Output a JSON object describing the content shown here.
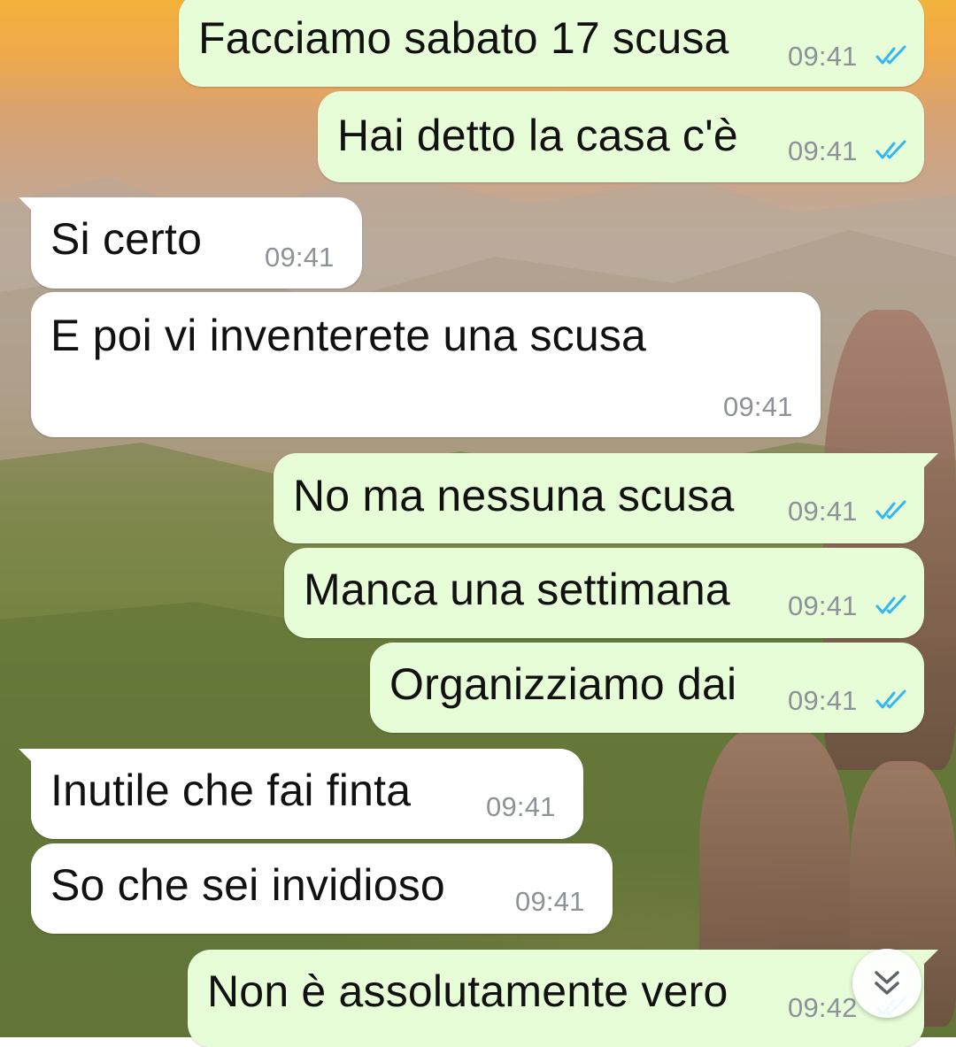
{
  "messages": [
    {
      "text": "Facciamo sabato 17 scusa",
      "time": "09:41",
      "direction": "out",
      "status": "read"
    },
    {
      "text": "Hai detto la casa c'è",
      "time": "09:41",
      "direction": "out",
      "status": "read"
    },
    {
      "text": "Si certo",
      "time": "09:41",
      "direction": "in"
    },
    {
      "text": "E poi vi inventerete una scusa",
      "time": "09:41",
      "direction": "in"
    },
    {
      "text": "No ma nessuna scusa",
      "time": "09:41",
      "direction": "out",
      "status": "read"
    },
    {
      "text": "Manca una settimana",
      "time": "09:41",
      "direction": "out",
      "status": "read"
    },
    {
      "text": "Organizziamo dai",
      "time": "09:41",
      "direction": "out",
      "status": "read"
    },
    {
      "text": "Inutile che fai finta",
      "time": "09:41",
      "direction": "in"
    },
    {
      "text": "So che sei invidioso",
      "time": "09:41",
      "direction": "in"
    },
    {
      "text": "Non è assolutamente vero",
      "time": "09:42",
      "direction": "out",
      "status": "read"
    }
  ],
  "colors": {
    "outgoing_bubble": "#e7fdd8",
    "incoming_bubble": "#ffffff",
    "read_ticks": "#34b7f1",
    "timestamp": "#8d9299"
  },
  "icons": {
    "read_receipt": "double-check-icon",
    "scroll_down": "double-chevron-down-icon"
  }
}
